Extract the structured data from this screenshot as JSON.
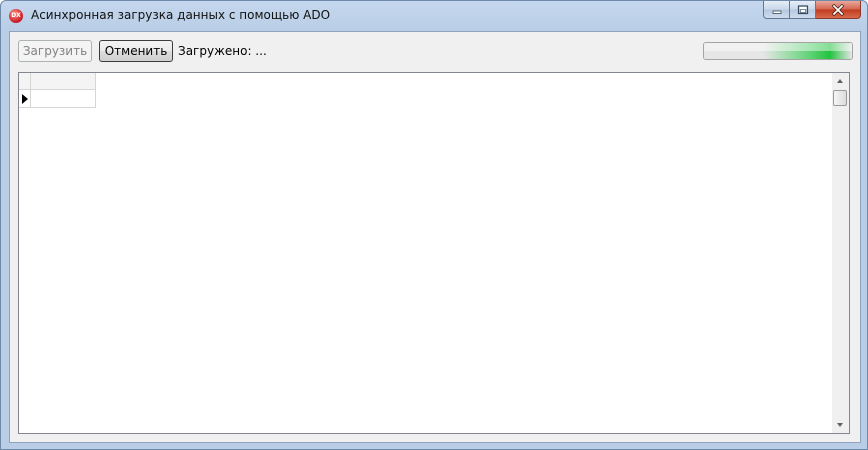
{
  "window": {
    "title": "Асинхронная загрузка данных с помощью ADO",
    "app_icon_text": "DX",
    "controls": {
      "minimize_icon": "minimize-icon",
      "maximize_icon": "maximize-icon",
      "close_icon": "close-icon"
    }
  },
  "toolbar": {
    "load_label": "Загрузить",
    "load_enabled": false,
    "cancel_label": "Отменить",
    "cancel_enabled": true,
    "status_text": "Загружено: ...",
    "progress_style": "marquee",
    "progress_color": "#22c33f"
  },
  "grid": {
    "columns": [
      ""
    ],
    "rows": [
      [
        ""
      ]
    ],
    "current_row_indicator": "row-pointer-icon"
  }
}
